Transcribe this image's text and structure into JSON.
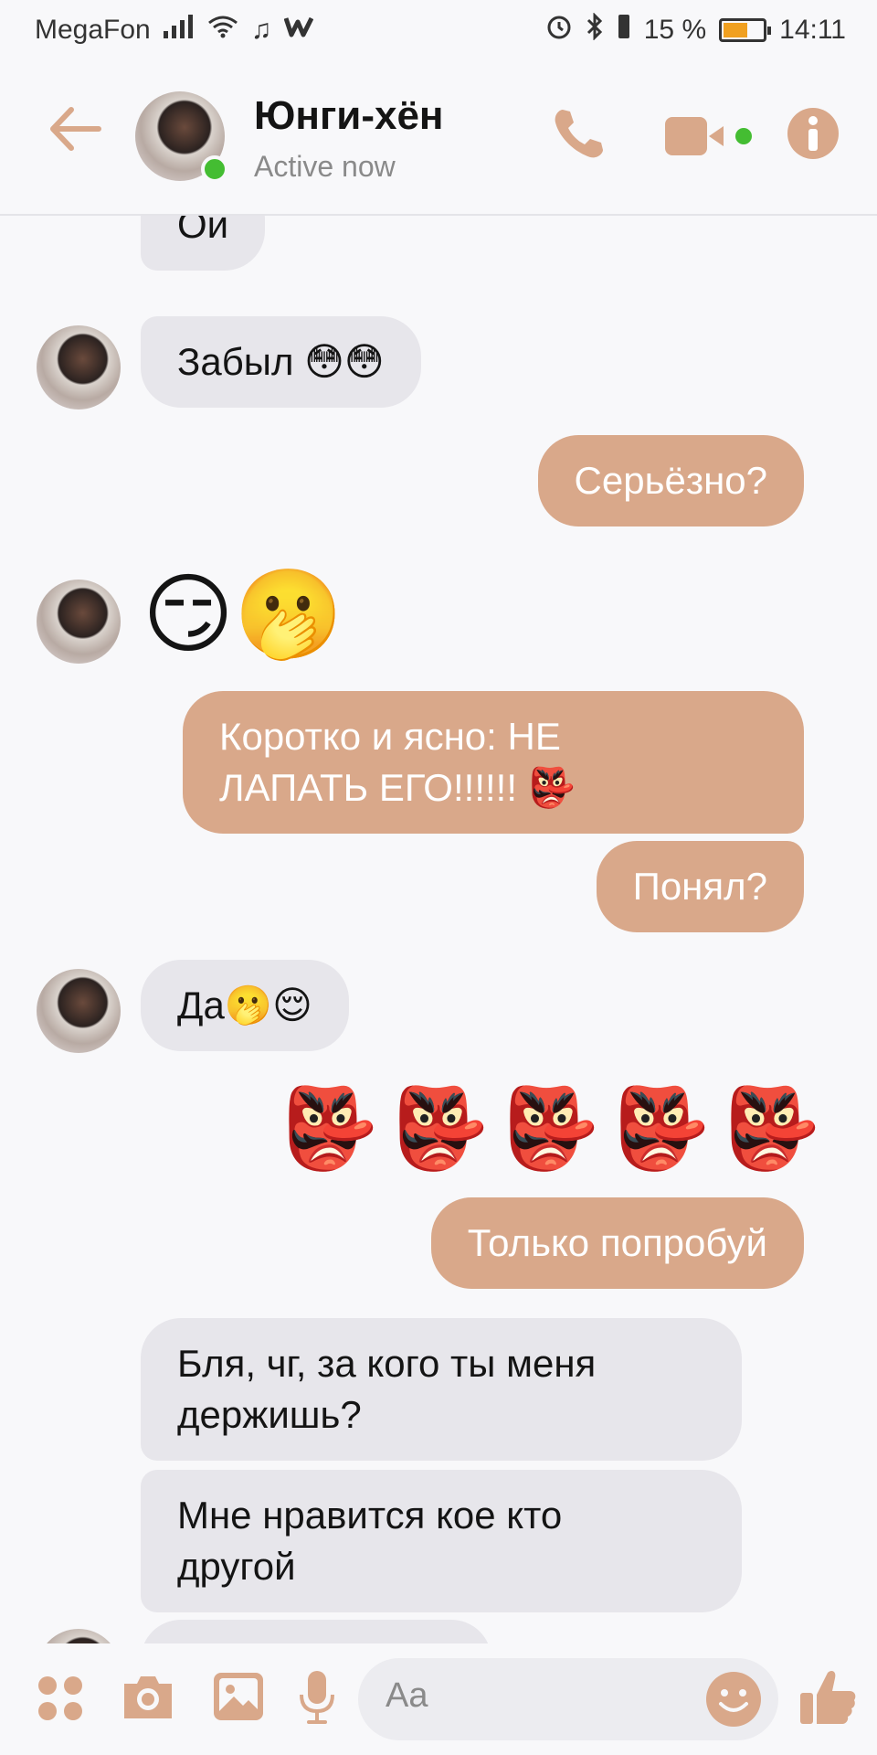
{
  "status_bar": {
    "carrier": "MegaFon",
    "battery_percent": "15 %",
    "time": "14:11"
  },
  "header": {
    "contact_name": "Юнги-хён",
    "contact_status": "Active now"
  },
  "messages": [
    {
      "side": "in",
      "text": "Ой"
    },
    {
      "side": "in",
      "text": "Забыл 😳😳"
    },
    {
      "side": "out",
      "text": "Серьёзно?"
    },
    {
      "side": "in",
      "text": "😏🫢"
    },
    {
      "side": "out",
      "text": "Коротко и ясно: НЕ\nЛАПАТЬ ЕГО!!!!!! 👺"
    },
    {
      "side": "out",
      "text": "Понял?"
    },
    {
      "side": "in",
      "text": "Да🫢😌"
    },
    {
      "side": "out",
      "text": "👺👺👺👺👺"
    },
    {
      "side": "out",
      "text": "Только попробуй"
    },
    {
      "side": "in",
      "text": "Бля, чг, за кого ты меня\nдержишь?"
    },
    {
      "side": "in",
      "text": "Мне нравится кое кто\nдругой"
    }
  ],
  "composer": {
    "placeholder": "Aa"
  },
  "colors": {
    "accent": "#d9a88a",
    "incoming_bubble": "#e7e6eb",
    "online": "#44bd32"
  },
  "icons": [
    "back-arrow-icon",
    "phone-icon",
    "video-camera-icon",
    "info-icon",
    "menu-dots-icon",
    "camera-icon",
    "image-icon",
    "microphone-icon",
    "smile-icon",
    "thumbs-up-icon"
  ]
}
